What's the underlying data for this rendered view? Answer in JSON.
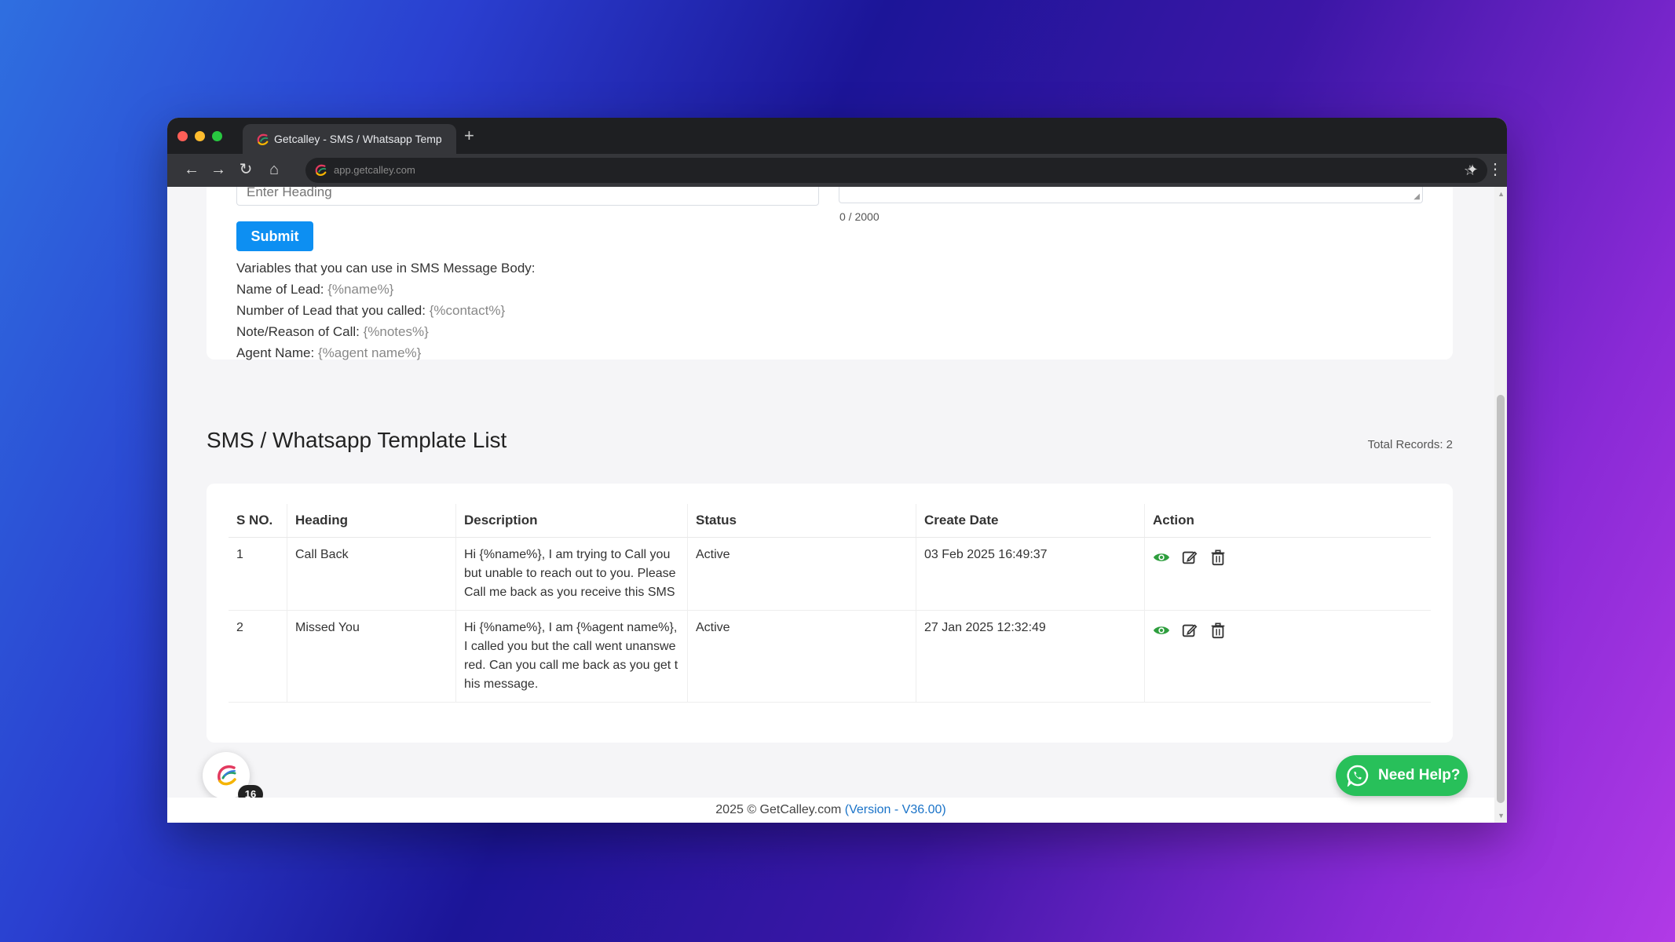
{
  "browser": {
    "tab_title": "Getcalley - SMS / Whatsapp Temp",
    "new_tab_symbol": "+",
    "url": "app.getcalley.com",
    "favicon_icon": "getcalley-logo-icon"
  },
  "form": {
    "heading_placeholder": "Enter Heading",
    "char_counter": "0 / 2000",
    "submit_label": "Submit",
    "variables_title": "Variables that you can use in SMS Message Body:",
    "variables": [
      {
        "label": "Name of Lead:",
        "code": "{%name%}"
      },
      {
        "label": "Number of Lead that you called:",
        "code": "{%contact%}"
      },
      {
        "label": "Note/Reason of Call:",
        "code": "{%notes%}"
      },
      {
        "label": "Agent Name:",
        "code": "{%agent name%}"
      }
    ]
  },
  "list": {
    "title": "SMS / Whatsapp Template List",
    "total_records": "Total Records: 2",
    "columns": [
      "S NO.",
      "Heading",
      "Description",
      "Status",
      "Create Date",
      "Action"
    ],
    "rows": [
      {
        "sno": "1",
        "heading": "Call Back",
        "description": "Hi {%name%}, I am trying to Call you but unable to reach out to you. Please Call me back as you receive this SMS",
        "status": "Active",
        "create_date": "03 Feb 2025 16:49:37"
      },
      {
        "sno": "2",
        "heading": "Missed You",
        "description": "Hi {%name%}, I am {%agent name%}, I called you but the call went unanswered. Can you call me back as you get this message.",
        "status": "Active",
        "create_date": "27 Jan 2025 12:32:49"
      }
    ],
    "action_icons": [
      "eye-icon",
      "edit-icon",
      "trash-icon"
    ]
  },
  "widget": {
    "badge_count": "16"
  },
  "footer": {
    "copyright": "2025 © GetCalley.com",
    "version": "(Version - V36.00)"
  },
  "help": {
    "label": "Need Help?"
  },
  "colors": {
    "primary": "#0d8ff2",
    "help_green": "#28c05a",
    "eye_green": "#2e9e3e",
    "link": "#1a73c8"
  }
}
